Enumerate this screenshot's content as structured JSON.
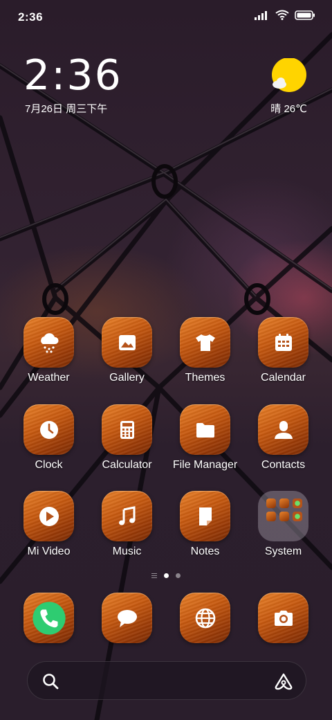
{
  "status_bar": {
    "time": "2:36",
    "icons": [
      "signal-icon",
      "wifi-icon",
      "battery-icon"
    ]
  },
  "clock_widget": {
    "time": "2:36",
    "date": "7月26日 周三下午"
  },
  "weather_widget": {
    "icon": "sunny-cloud-icon",
    "text": "晴 26℃"
  },
  "apps": [
    {
      "label": "Weather",
      "icon": "weather-icon"
    },
    {
      "label": "Gallery",
      "icon": "gallery-icon"
    },
    {
      "label": "Themes",
      "icon": "themes-icon"
    },
    {
      "label": "Calendar",
      "icon": "calendar-icon"
    },
    {
      "label": "Clock",
      "icon": "clock-icon"
    },
    {
      "label": "Calculator",
      "icon": "calculator-icon"
    },
    {
      "label": "File Manager",
      "icon": "folder-icon"
    },
    {
      "label": "Contacts",
      "icon": "contacts-icon"
    },
    {
      "label": "Mi Video",
      "icon": "video-icon"
    },
    {
      "label": "Music",
      "icon": "music-icon"
    },
    {
      "label": "Notes",
      "icon": "notes-icon"
    },
    {
      "label": "System",
      "icon": "system-folder-icon"
    }
  ],
  "pager": {
    "pages": 2,
    "active": 0
  },
  "dock": [
    {
      "icon": "phone-icon"
    },
    {
      "icon": "messages-icon"
    },
    {
      "icon": "browser-icon"
    },
    {
      "icon": "camera-icon"
    }
  ],
  "search_bar": {
    "left_icon": "search-icon",
    "right_icon": "assistant-icon"
  },
  "colors": {
    "icon_orange": "#c85a10",
    "sun_yellow": "#ffd400",
    "phone_green": "#2ecc71"
  }
}
